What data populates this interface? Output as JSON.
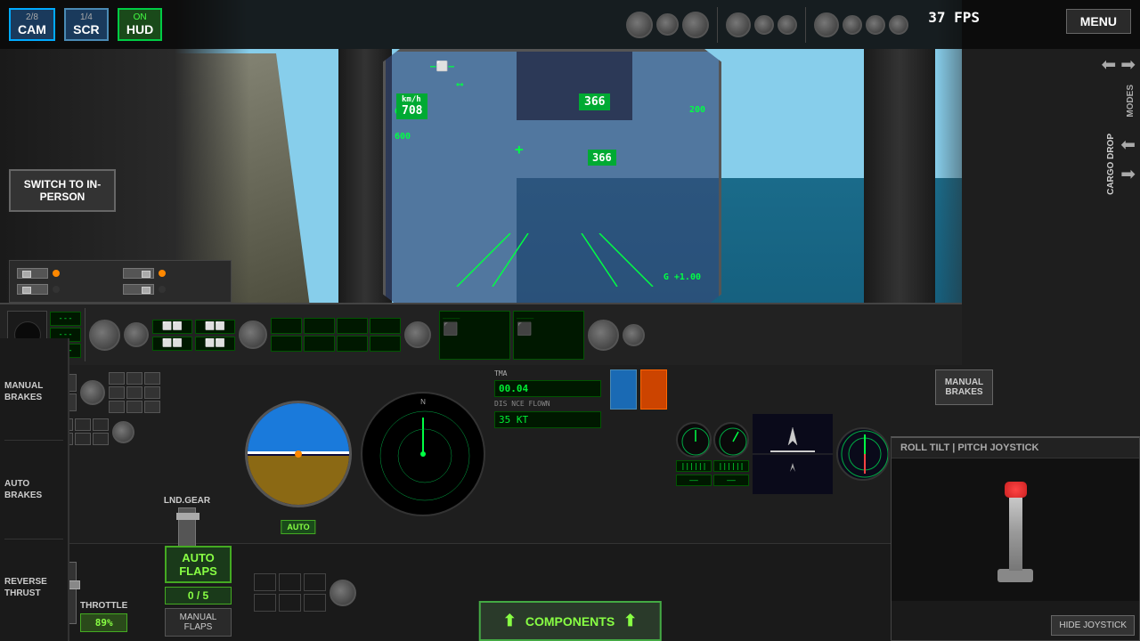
{
  "header": {
    "cam_label": "CAM",
    "cam_number": "2/8",
    "scr_label": "SCR",
    "scr_number": "1/4",
    "hud_label": "HUD",
    "hud_status": "ON",
    "fps": "37 FPS",
    "menu": "MENU"
  },
  "hud": {
    "speed": "708",
    "speed_unit": "km/h",
    "altitude": "366",
    "altitude2": "366",
    "speed_scale": [
      "650",
      "600"
    ],
    "alt_scale": [
      "200"
    ],
    "g_force": "G +1.00"
  },
  "left_panel": {
    "switch_to_label": "SWITCH TO\nIN-PERSON",
    "manual_brakes": "MANUAL\nBRAKES",
    "auto_brakes": "AUTO\nBRAKES",
    "reverse_thrust": "REVERSE\nTHRUST",
    "throttle_label": "THROTTLE",
    "throttle_value": "89%",
    "lnd_gear_label": "LND.GEAR",
    "auto_flaps": "AUTO\nFLAPS",
    "flaps_value": "0 / 5",
    "manual_flaps": "MANUAL\nFLAPS"
  },
  "right_panel": {
    "modes_label": "MODES",
    "cargo_drop_label": "CARGO\nDROP",
    "manual_brakes_label": "MANUAL\nBRAKES",
    "joystick_title": "ROLL TILT  |  PITCH JOYSTICK",
    "hide_joystick": "HIDE\nJOYSTICK"
  },
  "bottom_bar": {
    "components_label": "COMPONENTS"
  },
  "instruments": {
    "dist_flown_label": "DIS NCE\nFLOWN",
    "dist_value": "00.04",
    "value2": "35 KT",
    "tma_label": "TMA",
    "auto_atc": "AUTO"
  }
}
